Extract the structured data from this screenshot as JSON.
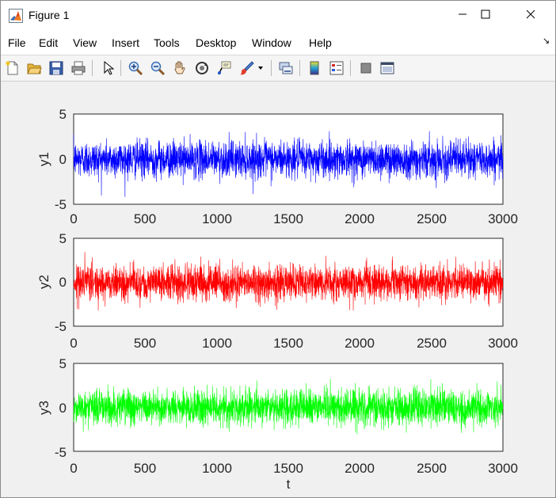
{
  "window": {
    "title": "Figure 1",
    "minimize_icon": "minimize-icon",
    "maximize_icon": "maximize-icon",
    "close_icon": "close-icon"
  },
  "menubar": {
    "items": [
      "File",
      "Edit",
      "View",
      "Insert",
      "Tools",
      "Desktop",
      "Window",
      "Help"
    ],
    "dock_arrow": "↘"
  },
  "toolbar": {
    "icons": [
      "new-figure-icon",
      "open-file-icon",
      "save-icon",
      "print-icon",
      "select-arrow-icon",
      "zoom-in-icon",
      "zoom-out-icon",
      "pan-hand-icon",
      "rotate-3d-icon",
      "data-cursor-icon",
      "brush-icon",
      "brush-dropdown-icon",
      "link-plot-icon",
      "colorbar-icon",
      "legend-icon",
      "hide-plot-tools-icon",
      "show-plot-tools-icon"
    ]
  },
  "chart_data": [
    {
      "type": "line",
      "ylabel": "y1",
      "xlim": [
        0,
        3000
      ],
      "ylim": [
        -5,
        5
      ],
      "xticks": [
        "0",
        "500",
        "1000",
        "1500",
        "2000",
        "2500",
        "3000"
      ],
      "yticks": [
        "5",
        "0",
        "-5"
      ],
      "color": "#0000ff",
      "series": [
        {
          "n_points": 3000,
          "mean": 0,
          "std": 1,
          "min": -4.2,
          "max": 3.1
        }
      ]
    },
    {
      "type": "line",
      "ylabel": "y2",
      "xlim": [
        0,
        3000
      ],
      "ylim": [
        -5,
        5
      ],
      "xticks": [
        "0",
        "500",
        "1000",
        "1500",
        "2000",
        "2500",
        "3000"
      ],
      "yticks": [
        "5",
        "0",
        "-5"
      ],
      "color": "#ff0000",
      "series": [
        {
          "n_points": 3000,
          "mean": 0,
          "std": 1,
          "min": -3.2,
          "max": 3.8
        }
      ]
    },
    {
      "type": "line",
      "ylabel": "y3",
      "xlabel": "t",
      "xlim": [
        0,
        3000
      ],
      "ylim": [
        -5,
        5
      ],
      "xticks": [
        "0",
        "500",
        "1000",
        "1500",
        "2000",
        "2500",
        "3000"
      ],
      "yticks": [
        "5",
        "0",
        "-5"
      ],
      "color": "#00ff00",
      "series": [
        {
          "n_points": 3000,
          "mean": 0,
          "std": 1,
          "min": -4.1,
          "max": 3.3
        }
      ]
    }
  ]
}
